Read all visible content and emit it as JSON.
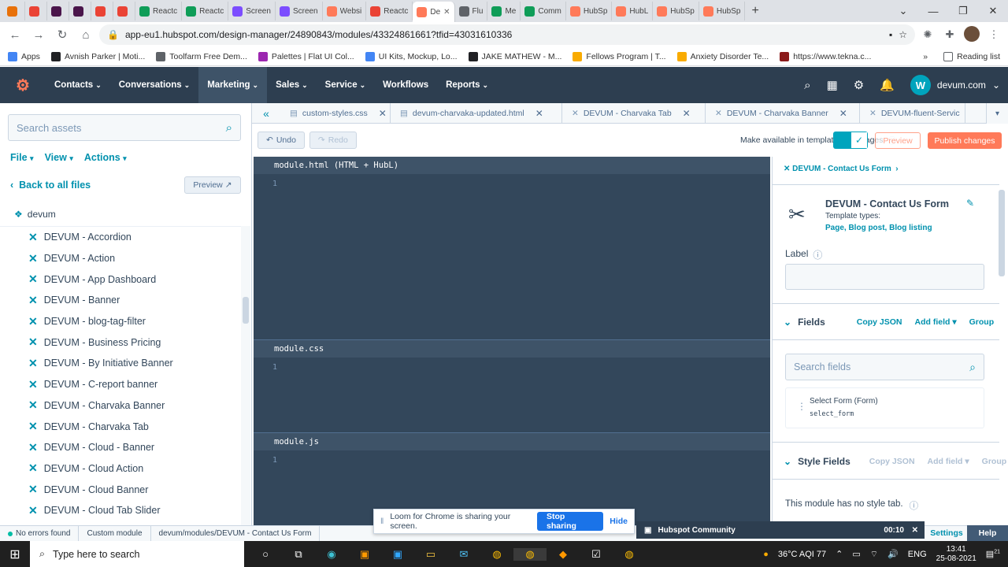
{
  "browser": {
    "tabs": [
      {
        "title": "",
        "color": "#e8710a"
      },
      {
        "title": "",
        "color": "#ea4335"
      },
      {
        "title": "",
        "color": "#4a154b"
      },
      {
        "title": "",
        "color": "#4a154b"
      },
      {
        "title": "",
        "color": "#ea4335"
      },
      {
        "title": "",
        "color": "#ea4335"
      },
      {
        "title": "Reactc",
        "color": "#0f9d58"
      },
      {
        "title": "Reactc",
        "color": "#0f9d58"
      },
      {
        "title": "Screen",
        "color": "#7c4dff"
      },
      {
        "title": "Screen",
        "color": "#7c4dff"
      },
      {
        "title": "Websi",
        "color": "#ff7a59"
      },
      {
        "title": "Reactc",
        "color": "#ea4335"
      },
      {
        "title": "De",
        "color": "#ff7a59",
        "active": true
      },
      {
        "title": "Flu",
        "color": "#5f6368"
      },
      {
        "title": "Me",
        "color": "#0f9d58"
      },
      {
        "title": "Comm",
        "color": "#0f9d58"
      },
      {
        "title": "HubSp",
        "color": "#ff7a59"
      },
      {
        "title": "HubL",
        "color": "#ff7a59"
      },
      {
        "title": "HubSp",
        "color": "#ff7a59"
      },
      {
        "title": "HubSp",
        "color": "#ff7a59"
      }
    ],
    "url": "app-eu1.hubspot.com/design-manager/24890843/modules/43324861661?tfid=43031610336",
    "bookmarks": [
      {
        "label": "Apps",
        "color": "#4285f4"
      },
      {
        "label": "Avnish Parker | Moti...",
        "color": "#202124"
      },
      {
        "label": "Toolfarm Free Dem...",
        "color": "#5f6368"
      },
      {
        "label": "Palettes | Flat UI Col...",
        "color": "#9c27b0"
      },
      {
        "label": "UI Kits, Mockup, Lo...",
        "color": "#4285f4"
      },
      {
        "label": "JAKE MATHEW - M...",
        "color": "#202124"
      },
      {
        "label": "Fellows Program | T...",
        "color": "#f9ab00"
      },
      {
        "label": "Anxiety Disorder Te...",
        "color": "#f9ab00"
      },
      {
        "label": "https://www.tekna.c...",
        "color": "#8b1a1a"
      }
    ],
    "reading_list": "Reading list"
  },
  "hubspot": {
    "nav": [
      {
        "label": "Contacts"
      },
      {
        "label": "Conversations"
      },
      {
        "label": "Marketing",
        "active": true
      },
      {
        "label": "Sales"
      },
      {
        "label": "Service"
      },
      {
        "label": "Workflows",
        "nochev": true
      },
      {
        "label": "Reports"
      }
    ],
    "account": "devum.com",
    "account_initial": "W"
  },
  "sidebar": {
    "search_placeholder": "Search assets",
    "menus": [
      "File",
      "View",
      "Actions"
    ],
    "back": "Back to all files",
    "preview": "Preview",
    "folder": "devum",
    "files": [
      "DEVUM - Accordion",
      "DEVUM - Action",
      "DEVUM - App Dashboard",
      "DEVUM - Banner",
      "DEVUM - blog-tag-filter",
      "DEVUM - Business Pricing",
      "DEVUM - By Initiative Banner",
      "DEVUM - C-report banner",
      "DEVUM - Charvaka Banner",
      "DEVUM - Charvaka Tab",
      "DEVUM - Cloud - Banner",
      "DEVUM - Cloud Action",
      "DEVUM - Cloud Banner",
      "DEVUM - Cloud Tab Slider"
    ]
  },
  "editor": {
    "file_tabs": [
      {
        "label": "custom-styles.css",
        "w": 140
      },
      {
        "label": "devum-charvaka-updated.html",
        "w": 218
      },
      {
        "label": "DEVUM - Charvaka Tab",
        "w": 182
      },
      {
        "label": "DEVUM - Charvaka Banner",
        "w": 196
      },
      {
        "label": "DEVUM-fluent-Servic",
        "w": 134
      }
    ],
    "undo": "Undo",
    "redo": "Redo",
    "make_available": "Make available in templates and pages",
    "preview": "Preview",
    "publish": "Publish changes",
    "panels": [
      {
        "title": "module.html (HTML + HubL)",
        "line": "1"
      },
      {
        "title": "module.css",
        "line": "1"
      },
      {
        "title": "module.js",
        "line": "1"
      }
    ]
  },
  "inspector": {
    "breadcrumb": "DEVUM - Contact Us Form",
    "module_title": "DEVUM - Contact Us Form",
    "template_types_label": "Template types:",
    "template_types": "Page, Blog post, Blog listing",
    "label_field": "Label",
    "fields": {
      "title": "Fields",
      "copy_json": "Copy JSON",
      "add_field": "Add field",
      "group": "Group",
      "search_placeholder": "Search fields",
      "item_name": "Select Form (Form)",
      "item_id": "select_form"
    },
    "style_fields": {
      "title": "Style Fields",
      "copy_json": "Copy JSON",
      "add_field": "Add field",
      "group": "Group",
      "empty": "This module has no style tab."
    }
  },
  "status": {
    "errors": "No errors found",
    "type": "Custom module",
    "path": "devum/modules/DEVUM - Contact Us Form",
    "community": "Hubspot Community",
    "community_time": "00:10",
    "settings": "Settings",
    "help": "Help"
  },
  "loom": {
    "message": "Loom for Chrome is sharing your screen.",
    "stop": "Stop sharing",
    "hide": "Hide"
  },
  "taskbar": {
    "search_placeholder": "Type here to search",
    "weather": "36°C AQI 77",
    "lang": "ENG",
    "time": "13:41",
    "date": "25-08-2021",
    "notif": "21"
  }
}
